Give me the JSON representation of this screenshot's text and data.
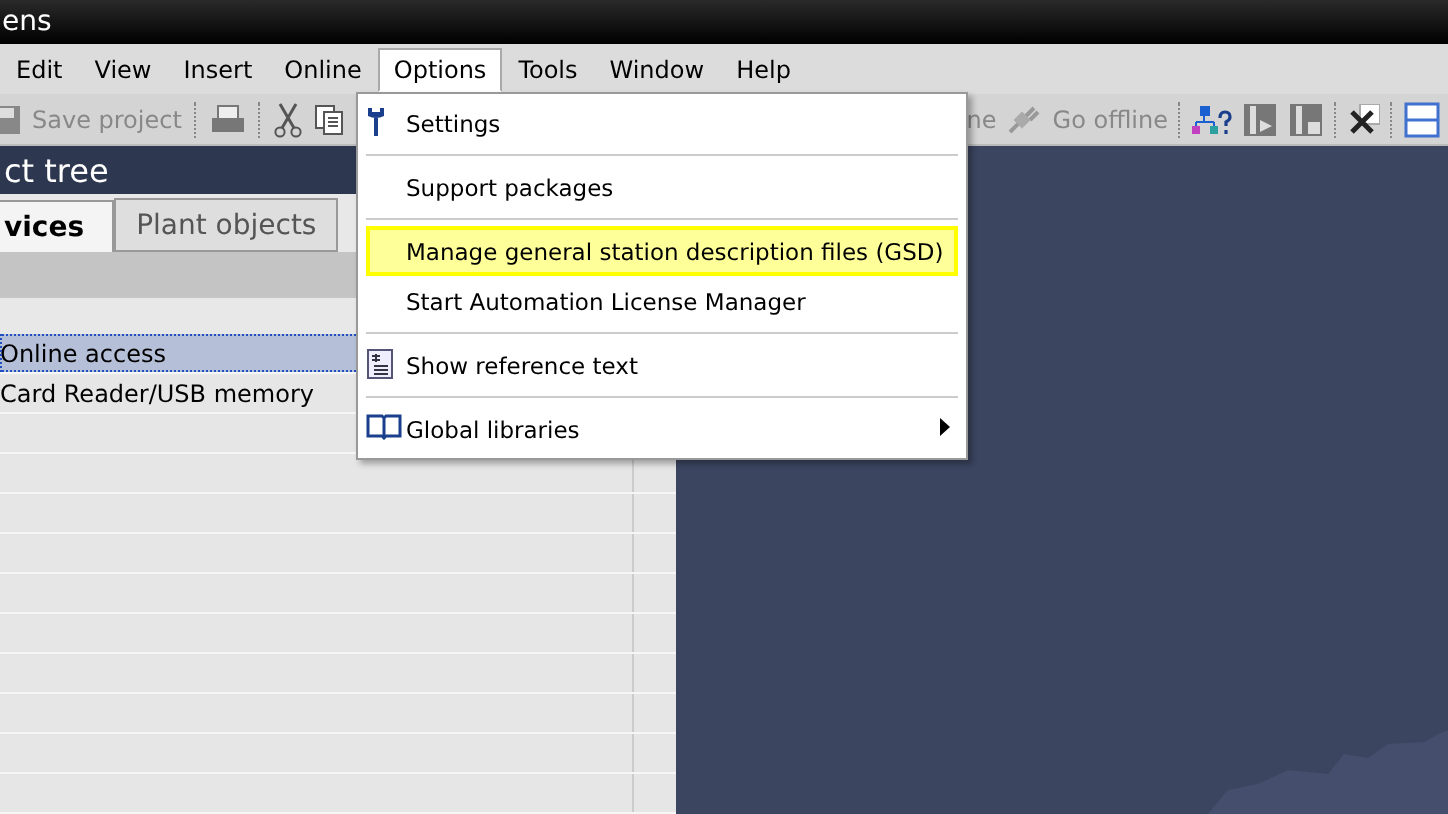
{
  "window": {
    "title": "ens"
  },
  "menu_bar": [
    {
      "label": "Edit",
      "selected": false
    },
    {
      "label": "View",
      "selected": false
    },
    {
      "label": "Insert",
      "selected": false
    },
    {
      "label": "Online",
      "selected": false
    },
    {
      "label": "Options",
      "selected": true
    },
    {
      "label": "Tools",
      "selected": false
    },
    {
      "label": "Window",
      "selected": false
    },
    {
      "label": "Help",
      "selected": false
    }
  ],
  "toolbar": {
    "save_label": "Save project",
    "online_label": "ne",
    "offline_label": "Go offline"
  },
  "project_tree": {
    "title": "ct tree",
    "tabs": [
      {
        "label": "vices",
        "selected": true
      },
      {
        "label": "Plant objects",
        "selected": false
      }
    ],
    "rows": [
      {
        "label": "Online access",
        "selected": true
      },
      {
        "label": "Card Reader/USB memory",
        "selected": false
      }
    ]
  },
  "options_menu": [
    {
      "items": [
        {
          "label": "Settings",
          "kind": "wrench",
          "submenu": false,
          "selected": false
        }
      ]
    },
    {
      "items": [
        {
          "label": "Support packages",
          "kind": "plain",
          "submenu": false,
          "selected": false
        }
      ]
    },
    {
      "items": [
        {
          "label": "Manage general station description files (GSD)",
          "kind": "plain",
          "submenu": false,
          "selected": true
        },
        {
          "label": "Start Automation License Manager",
          "kind": "plain",
          "submenu": false,
          "selected": false
        }
      ]
    },
    {
      "items": [
        {
          "label": "Show reference text",
          "kind": "document",
          "submenu": false,
          "selected": false
        }
      ]
    },
    {
      "items": [
        {
          "label": "Global libraries",
          "kind": "book",
          "submenu": true,
          "selected": false
        }
      ]
    }
  ]
}
